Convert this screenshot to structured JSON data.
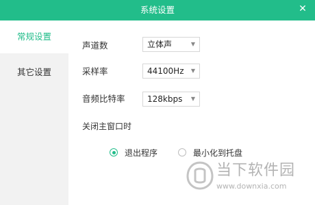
{
  "window": {
    "title": "系统设置",
    "close_glyph": "✕",
    "accent_color": "#22bd8a"
  },
  "sidebar": {
    "items": [
      {
        "label": "常规设置",
        "active": true
      },
      {
        "label": "其它设置",
        "active": false
      }
    ]
  },
  "settings": {
    "channels": {
      "label": "声道数",
      "value": "立体声"
    },
    "sample_rate": {
      "label": "采样率",
      "value": "44100Hz"
    },
    "bitrate": {
      "label": "音频比特率",
      "value": "128kbps"
    },
    "dropdown_icon": "triangle-down-icon"
  },
  "close_main_window": {
    "label": "关闭主窗口时",
    "options": [
      {
        "label": "退出程序",
        "checked": true
      },
      {
        "label": "最小化到托盘",
        "checked": false
      }
    ]
  },
  "watermark": {
    "brand": "当下软件园",
    "url": "www.downxia.com"
  }
}
